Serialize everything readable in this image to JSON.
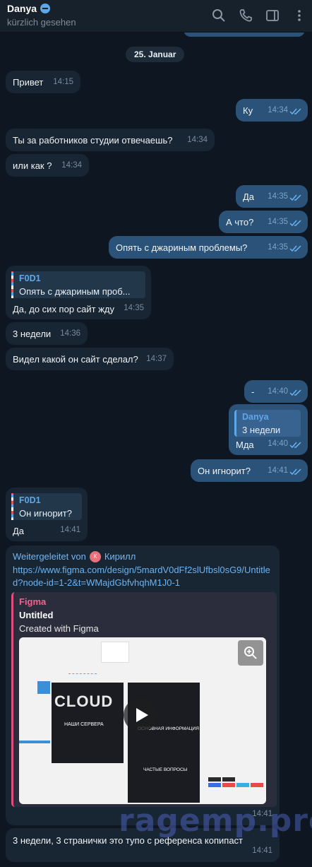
{
  "header": {
    "contact_name": "Danya",
    "status": "kürzlich gesehen",
    "icons": [
      "search-icon",
      "phone-icon",
      "sidebar-toggle-icon",
      "more-vert-icon"
    ]
  },
  "date_separator": "25. Januar",
  "messages": [
    {
      "text": "Привет",
      "time": "14:15",
      "dir": "in"
    },
    {
      "text": "Ку",
      "time": "14:34",
      "dir": "out"
    },
    {
      "text": "Ты за работников студии отвечаешь?",
      "time": "14:34",
      "dir": "in"
    },
    {
      "text": "или как ?",
      "time": "14:34",
      "dir": "in"
    },
    {
      "text": "Да",
      "time": "14:35",
      "dir": "out"
    },
    {
      "text": "А что?",
      "time": "14:35",
      "dir": "out"
    },
    {
      "text": "Опять с джариным проблемы?",
      "time": "14:35",
      "dir": "out"
    },
    {
      "text": "Да, до сих пор сайт жду",
      "time": "14:35",
      "dir": "in",
      "reply_name": "F0D1",
      "reply_text": "Опять с джариным проб..."
    },
    {
      "text": "3 недели",
      "time": "14:36",
      "dir": "in"
    },
    {
      "text": "Видел какой он сайт сделал?",
      "time": "14:37",
      "dir": "in"
    },
    {
      "text": "-",
      "time": "14:40",
      "dir": "out"
    },
    {
      "text": "Мда",
      "time": "14:40",
      "dir": "out",
      "reply_name": "Danya",
      "reply_text": "3 недели"
    },
    {
      "text": "Он игнорит?",
      "time": "14:41",
      "dir": "out"
    },
    {
      "text": "Да",
      "time": "14:41",
      "dir": "in",
      "reply_name": "F0D1",
      "reply_text": "Он игнорит?"
    },
    {
      "text": "3 недели, 3 странички это тупо с референса копипаст",
      "time": "14:41",
      "dir": "in"
    }
  ],
  "forwarded": {
    "label": "Weitergeleitet von",
    "from_initial": "К",
    "from_name": "Кирилл",
    "url": "https://www.figma.com/design/5mardV0dFf2slUfbsl0sG9/Untitled?node-id=1-2&t=WMajdGbfvhqhM1J0-1",
    "preview_site": "Figma",
    "preview_title": "Untitled",
    "preview_desc": "Created with Figma",
    "time": "14:41",
    "thumb_brand": "CLOUD",
    "thumb_heading_1": "НАШИ СЕРВЕРА",
    "thumb_heading_2": "ОСНОВНАЯ ИНФОРМАЦИЯ",
    "thumb_heading_3": "ЧАСТЫЕ ВОПРОСЫ"
  },
  "watermark": "ragemp.pro",
  "colors": {
    "incoming": "#182533",
    "outgoing": "#2b5278",
    "background": "#0e1621",
    "accent": "#5fa8e8"
  }
}
